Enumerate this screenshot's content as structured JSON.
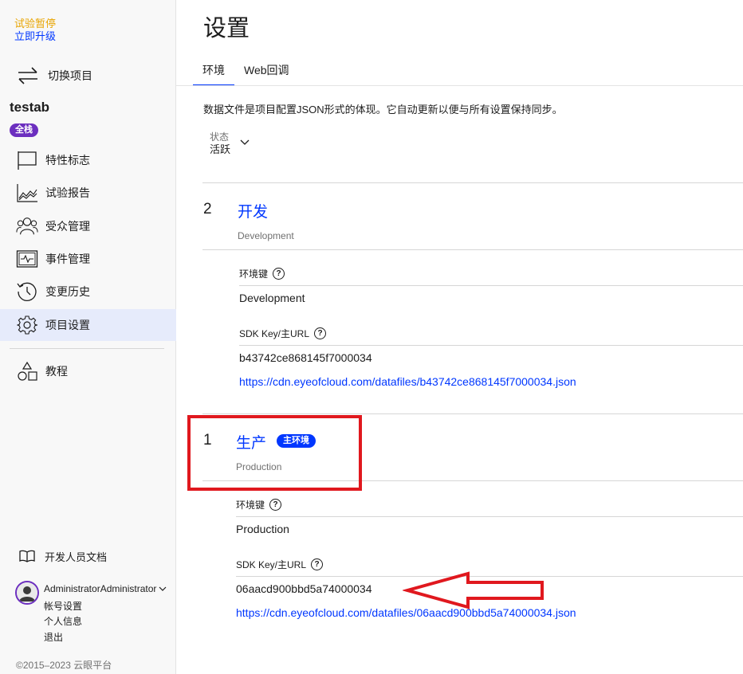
{
  "sidebar": {
    "trial_label": "试验暂停",
    "upgrade_label": "立即升级",
    "switch_project_label": "切换项目",
    "project_name": "testab",
    "project_badge": "全栈",
    "nav_items": [
      {
        "label": "特性标志",
        "icon": "flag-icon"
      },
      {
        "label": "试验报告",
        "icon": "chart-icon"
      },
      {
        "label": "受众管理",
        "icon": "audience-icon"
      },
      {
        "label": "事件管理",
        "icon": "event-icon"
      },
      {
        "label": "变更历史",
        "icon": "history-icon"
      },
      {
        "label": "项目设置",
        "icon": "gear-icon",
        "active": true
      }
    ],
    "tutorial_label": "教程",
    "dev_docs_label": "开发人员文档",
    "user": {
      "name": "AdministratorAdministrator",
      "menu": [
        "帐号设置",
        "个人信息",
        "退出"
      ]
    },
    "copyright": "©2015–2023 云眼平台"
  },
  "main": {
    "title": "设置",
    "tabs": [
      {
        "label": "环境",
        "active": true
      },
      {
        "label": "Web回调"
      }
    ],
    "intro": "数据文件是项目配置JSON形式的体现。它自动更新以便与所有设置保持同步。",
    "status": {
      "label": "状态",
      "value": "活跃"
    },
    "environments": [
      {
        "number": "2",
        "name": "开发",
        "subtitle": "Development",
        "key_label": "环境键",
        "key_value": "Development",
        "sdk_label": "SDK Key/主URL",
        "sdk_key": "b43742ce868145f7000034",
        "url": "https://cdn.eyeofcloud.com/datafiles/b43742ce868145f7000034.json"
      },
      {
        "number": "1",
        "name": "生产",
        "badge": "主环境",
        "subtitle": "Production",
        "key_label": "环境键",
        "key_value": "Production",
        "sdk_label": "SDK Key/主URL",
        "sdk_key": "06aacd900bbd5a74000034",
        "url": "https://cdn.eyeofcloud.com/datafiles/06aacd900bbd5a74000034.json"
      }
    ],
    "help_glyph": "?"
  },
  "colors": {
    "brand_blue": "#0037ff",
    "purple": "#6c2fbf",
    "trial_orange": "#e8a400",
    "annotation_red": "#e0181e"
  }
}
